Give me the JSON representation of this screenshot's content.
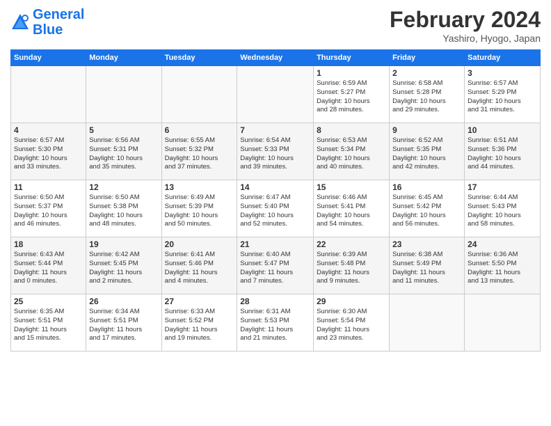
{
  "header": {
    "logo_line1": "General",
    "logo_line2": "Blue",
    "month": "February 2024",
    "location": "Yashiro, Hyogo, Japan"
  },
  "weekdays": [
    "Sunday",
    "Monday",
    "Tuesday",
    "Wednesday",
    "Thursday",
    "Friday",
    "Saturday"
  ],
  "weeks": [
    [
      {
        "num": "",
        "text": ""
      },
      {
        "num": "",
        "text": ""
      },
      {
        "num": "",
        "text": ""
      },
      {
        "num": "",
        "text": ""
      },
      {
        "num": "1",
        "text": "Sunrise: 6:59 AM\nSunset: 5:27 PM\nDaylight: 10 hours\nand 28 minutes."
      },
      {
        "num": "2",
        "text": "Sunrise: 6:58 AM\nSunset: 5:28 PM\nDaylight: 10 hours\nand 29 minutes."
      },
      {
        "num": "3",
        "text": "Sunrise: 6:57 AM\nSunset: 5:29 PM\nDaylight: 10 hours\nand 31 minutes."
      }
    ],
    [
      {
        "num": "4",
        "text": "Sunrise: 6:57 AM\nSunset: 5:30 PM\nDaylight: 10 hours\nand 33 minutes."
      },
      {
        "num": "5",
        "text": "Sunrise: 6:56 AM\nSunset: 5:31 PM\nDaylight: 10 hours\nand 35 minutes."
      },
      {
        "num": "6",
        "text": "Sunrise: 6:55 AM\nSunset: 5:32 PM\nDaylight: 10 hours\nand 37 minutes."
      },
      {
        "num": "7",
        "text": "Sunrise: 6:54 AM\nSunset: 5:33 PM\nDaylight: 10 hours\nand 39 minutes."
      },
      {
        "num": "8",
        "text": "Sunrise: 6:53 AM\nSunset: 5:34 PM\nDaylight: 10 hours\nand 40 minutes."
      },
      {
        "num": "9",
        "text": "Sunrise: 6:52 AM\nSunset: 5:35 PM\nDaylight: 10 hours\nand 42 minutes."
      },
      {
        "num": "10",
        "text": "Sunrise: 6:51 AM\nSunset: 5:36 PM\nDaylight: 10 hours\nand 44 minutes."
      }
    ],
    [
      {
        "num": "11",
        "text": "Sunrise: 6:50 AM\nSunset: 5:37 PM\nDaylight: 10 hours\nand 46 minutes."
      },
      {
        "num": "12",
        "text": "Sunrise: 6:50 AM\nSunset: 5:38 PM\nDaylight: 10 hours\nand 48 minutes."
      },
      {
        "num": "13",
        "text": "Sunrise: 6:49 AM\nSunset: 5:39 PM\nDaylight: 10 hours\nand 50 minutes."
      },
      {
        "num": "14",
        "text": "Sunrise: 6:47 AM\nSunset: 5:40 PM\nDaylight: 10 hours\nand 52 minutes."
      },
      {
        "num": "15",
        "text": "Sunrise: 6:46 AM\nSunset: 5:41 PM\nDaylight: 10 hours\nand 54 minutes."
      },
      {
        "num": "16",
        "text": "Sunrise: 6:45 AM\nSunset: 5:42 PM\nDaylight: 10 hours\nand 56 minutes."
      },
      {
        "num": "17",
        "text": "Sunrise: 6:44 AM\nSunset: 5:43 PM\nDaylight: 10 hours\nand 58 minutes."
      }
    ],
    [
      {
        "num": "18",
        "text": "Sunrise: 6:43 AM\nSunset: 5:44 PM\nDaylight: 11 hours\nand 0 minutes."
      },
      {
        "num": "19",
        "text": "Sunrise: 6:42 AM\nSunset: 5:45 PM\nDaylight: 11 hours\nand 2 minutes."
      },
      {
        "num": "20",
        "text": "Sunrise: 6:41 AM\nSunset: 5:46 PM\nDaylight: 11 hours\nand 4 minutes."
      },
      {
        "num": "21",
        "text": "Sunrise: 6:40 AM\nSunset: 5:47 PM\nDaylight: 11 hours\nand 7 minutes."
      },
      {
        "num": "22",
        "text": "Sunrise: 6:39 AM\nSunset: 5:48 PM\nDaylight: 11 hours\nand 9 minutes."
      },
      {
        "num": "23",
        "text": "Sunrise: 6:38 AM\nSunset: 5:49 PM\nDaylight: 11 hours\nand 11 minutes."
      },
      {
        "num": "24",
        "text": "Sunrise: 6:36 AM\nSunset: 5:50 PM\nDaylight: 11 hours\nand 13 minutes."
      }
    ],
    [
      {
        "num": "25",
        "text": "Sunrise: 6:35 AM\nSunset: 5:51 PM\nDaylight: 11 hours\nand 15 minutes."
      },
      {
        "num": "26",
        "text": "Sunrise: 6:34 AM\nSunset: 5:51 PM\nDaylight: 11 hours\nand 17 minutes."
      },
      {
        "num": "27",
        "text": "Sunrise: 6:33 AM\nSunset: 5:52 PM\nDaylight: 11 hours\nand 19 minutes."
      },
      {
        "num": "28",
        "text": "Sunrise: 6:31 AM\nSunset: 5:53 PM\nDaylight: 11 hours\nand 21 minutes."
      },
      {
        "num": "29",
        "text": "Sunrise: 6:30 AM\nSunset: 5:54 PM\nDaylight: 11 hours\nand 23 minutes."
      },
      {
        "num": "",
        "text": ""
      },
      {
        "num": "",
        "text": ""
      }
    ]
  ]
}
